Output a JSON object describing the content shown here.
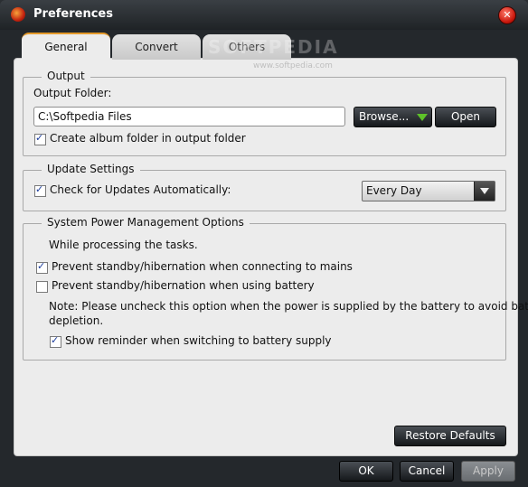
{
  "window": {
    "title": "Preferences"
  },
  "watermark": {
    "brand": "SOFTPEDIA",
    "url": "www.softpedia.com"
  },
  "tabs": [
    {
      "label": "General",
      "active": true
    },
    {
      "label": "Convert",
      "active": false
    },
    {
      "label": "Others",
      "active": false
    }
  ],
  "output": {
    "legend": "Output",
    "folder_label": "Output Folder:",
    "folder_value": "C:\\Softpedia Files",
    "browse_label": "Browse...",
    "open_label": "Open",
    "album_folder_label": "Create album folder in output folder",
    "album_folder_checked": true
  },
  "update": {
    "legend": "Update Settings",
    "check_label": "Check for Updates Automatically:",
    "check_checked": true,
    "frequency_value": "Every Day"
  },
  "power": {
    "legend": "System Power Management Options",
    "intro": "While processing the tasks.",
    "mains_label": "Prevent standby/hibernation when connecting to mains",
    "mains_checked": true,
    "battery_label": "Prevent standby/hibernation when using battery",
    "battery_checked": false,
    "note_line1": "Note: Please uncheck this option when the power is supplied by the battery to avoid battery",
    "note_line2": "depletion.",
    "reminder_label": "Show reminder when switching to battery supply",
    "reminder_checked": true
  },
  "buttons": {
    "restore_defaults": "Restore Defaults",
    "ok": "OK",
    "cancel": "Cancel",
    "apply": "Apply"
  },
  "colors": {
    "accent": "#e59a2b",
    "browse_arrow": "#5ec229"
  }
}
